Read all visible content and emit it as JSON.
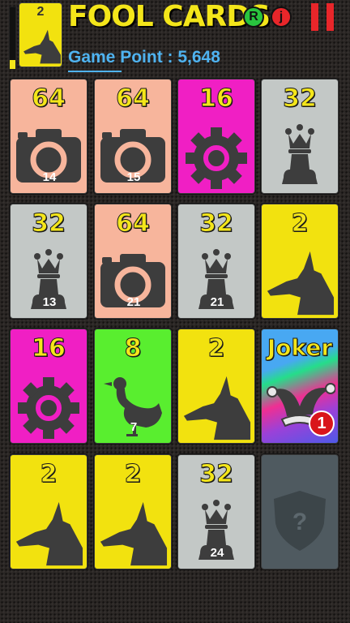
{
  "header": {
    "progress_fraction": 0.15,
    "current_card_value": "2",
    "current_card_icon": "anubis-icon",
    "title": "FOOL CARDS",
    "button_r": "R",
    "button_j": "j",
    "score_text": "Game Point : 5,648"
  },
  "colors": {
    "salmon": "#f7b59c",
    "magenta": "#f01fc4",
    "gray": "#c3c8c6",
    "yellow": "#f2e20f",
    "green": "#59ee2f",
    "hidden": "#4f5a60",
    "value_text": "#f4e61a",
    "score_text": "#4fb3f0",
    "pause": "#e8262a",
    "button_r": "#29c43e",
    "button_j": "#e8262a"
  },
  "board": [
    {
      "value": "64",
      "icon": "camera-icon",
      "color": "salmon",
      "number": "14"
    },
    {
      "value": "64",
      "icon": "camera-icon",
      "color": "salmon",
      "number": "15"
    },
    {
      "value": "16",
      "icon": "gear-icon",
      "color": "magenta",
      "number": ""
    },
    {
      "value": "32",
      "icon": "queen-icon",
      "color": "gray",
      "number": ""
    },
    {
      "value": "32",
      "icon": "queen-icon",
      "color": "gray",
      "number": "13"
    },
    {
      "value": "64",
      "icon": "camera-icon",
      "color": "salmon",
      "number": "21"
    },
    {
      "value": "32",
      "icon": "queen-icon",
      "color": "gray",
      "number": "21"
    },
    {
      "value": "2",
      "icon": "anubis-icon",
      "color": "yellow",
      "number": ""
    },
    {
      "value": "16",
      "icon": "gear-icon",
      "color": "magenta",
      "number": ""
    },
    {
      "value": "8",
      "icon": "duck-icon",
      "color": "green",
      "number": "7"
    },
    {
      "value": "2",
      "icon": "anubis-icon",
      "color": "yellow",
      "number": ""
    },
    {
      "value": "Joker",
      "icon": "jester-hat-icon",
      "color": "joker",
      "number": "",
      "badge": "1"
    },
    {
      "value": "2",
      "icon": "anubis-icon",
      "color": "yellow",
      "number": ""
    },
    {
      "value": "2",
      "icon": "anubis-icon",
      "color": "yellow",
      "number": ""
    },
    {
      "value": "32",
      "icon": "queen-icon",
      "color": "gray",
      "number": "24"
    },
    {
      "value": "",
      "icon": "shield-question-icon",
      "color": "hidden",
      "number": ""
    }
  ]
}
